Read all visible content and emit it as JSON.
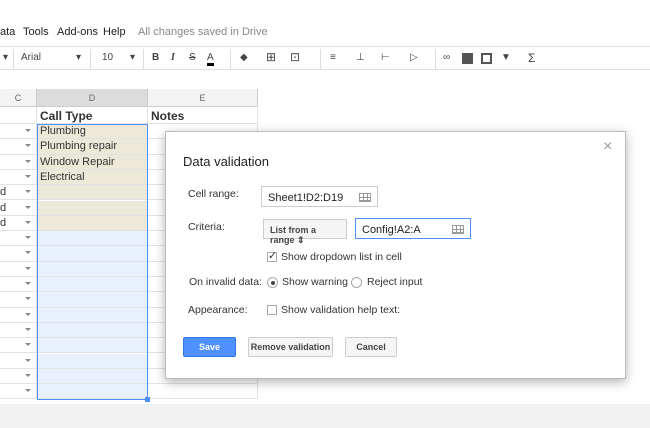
{
  "menu": {
    "items": [
      "ata",
      "Tools",
      "Add-ons",
      "Help"
    ],
    "status": "All changes saved in Drive"
  },
  "toolbar": {
    "font": "Arial",
    "size": "10",
    "bold": "B",
    "italic": "I",
    "strike": "S",
    "text_color": "A",
    "sigma": "Σ"
  },
  "columns": [
    "C",
    "D",
    "E"
  ],
  "header_row": {
    "d": "Call Type",
    "e": "Notes"
  },
  "col_c": [
    "",
    "",
    "",
    "",
    "d",
    "d",
    "d",
    "",
    "",
    "",
    "",
    "",
    "",
    "",
    "",
    "",
    "",
    ""
  ],
  "col_d": [
    "Plumbing",
    "Plumbing repair",
    "Window Repair",
    "Electrical",
    "",
    "",
    "",
    "",
    "",
    "",
    "",
    "",
    "",
    "",
    "",
    "",
    "",
    ""
  ],
  "colors": {
    "selected_fill": "#ece9d8",
    "range_fill": "#e8f0fe",
    "accent": "#4d90fe"
  },
  "dialog": {
    "title": "Data validation",
    "close": "×",
    "cell_range_label": "Cell range:",
    "cell_range_value": "Sheet1!D2:D19",
    "criteria_label": "Criteria:",
    "criteria_type": "List from a range",
    "criteria_value": "Config!A2:A",
    "show_dropdown": "Show dropdown list in cell",
    "show_dropdown_checked": true,
    "invalid_label": "On invalid data:",
    "show_warning": "Show warning",
    "reject_input": "Reject input",
    "invalid_selected": "Show warning",
    "appearance_label": "Appearance:",
    "help_text": "Show validation help text:",
    "help_text_checked": false,
    "save": "Save",
    "remove": "Remove validation",
    "cancel": "Cancel"
  }
}
